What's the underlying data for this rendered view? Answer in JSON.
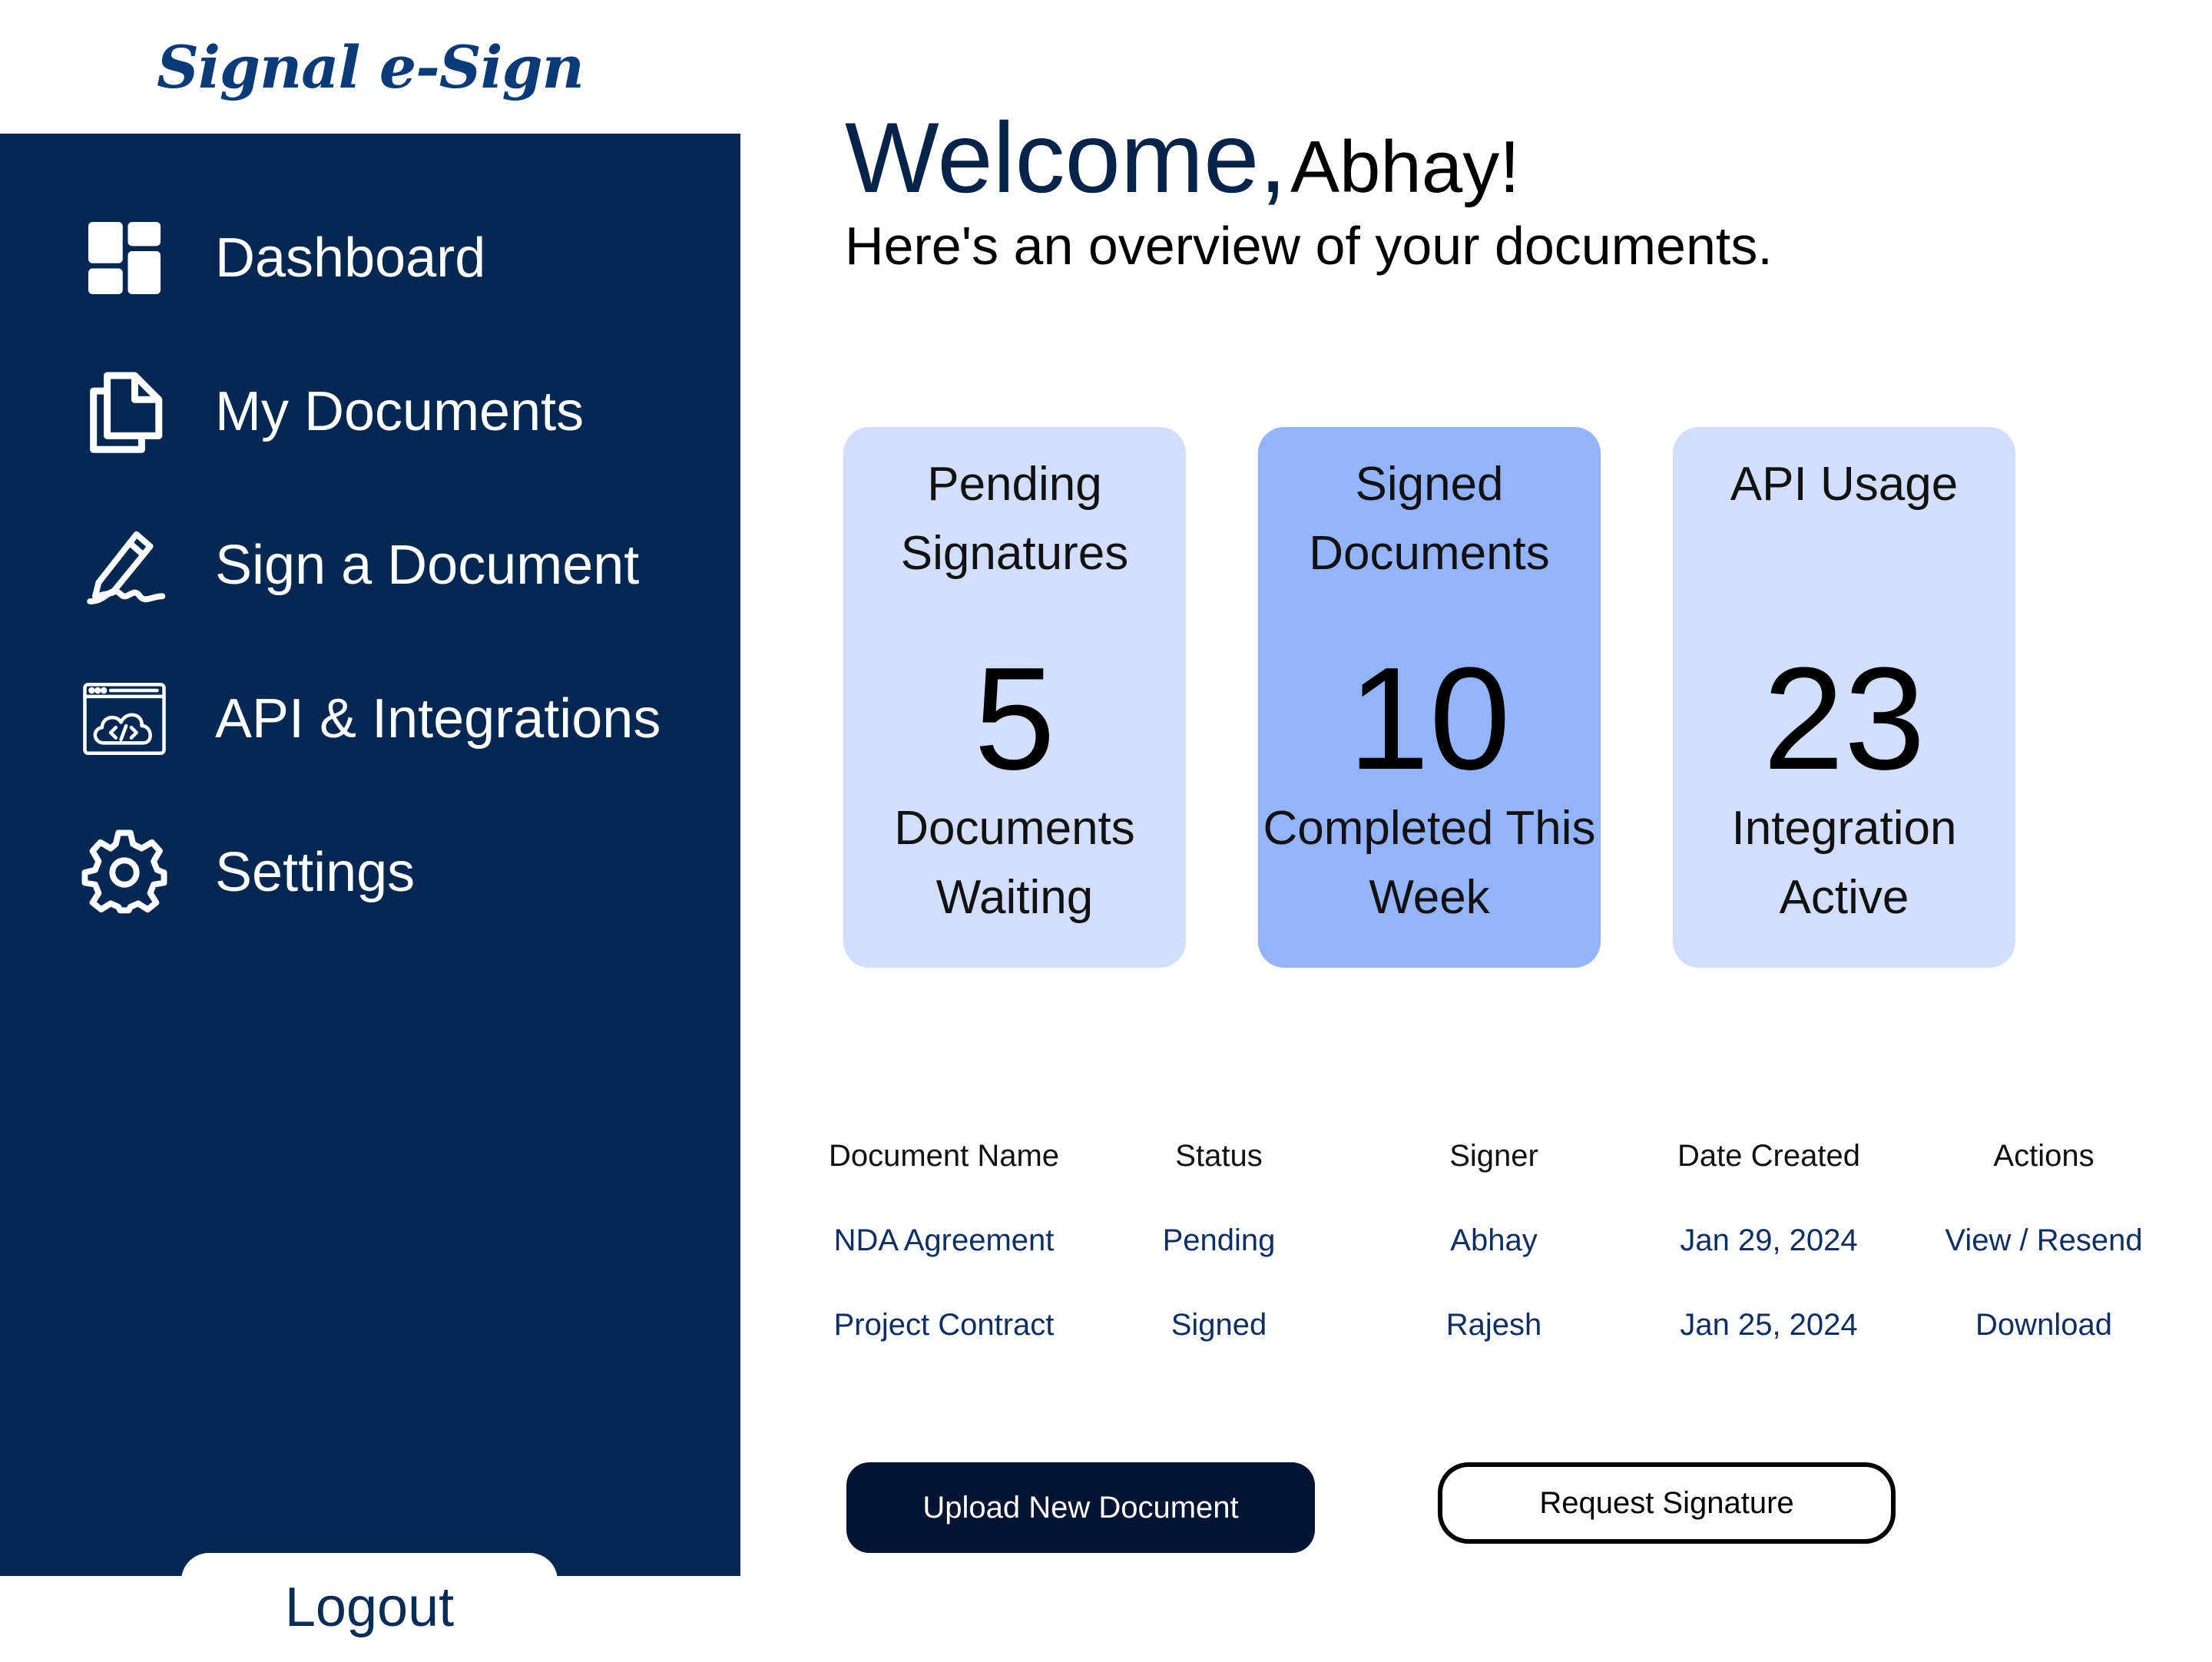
{
  "app": {
    "logo_text": "Signal e-Sign"
  },
  "sidebar": {
    "items": [
      {
        "label": "Dashboard",
        "icon": "dashboard-icon"
      },
      {
        "label": "My Documents",
        "icon": "documents-icon"
      },
      {
        "label": "Sign a Document",
        "icon": "signature-pen-icon"
      },
      {
        "label": "API & Integrations",
        "icon": "api-cloud-code-icon"
      },
      {
        "label": "Settings",
        "icon": "gear-icon"
      }
    ],
    "logout_label": "Logout"
  },
  "header": {
    "welcome": "Welcome,",
    "user_name": "Abhay!",
    "subtitle": "Here's an overview of your documents."
  },
  "cards": [
    {
      "title": "Pending Signatures",
      "value": "5",
      "description": "Documents Waiting",
      "bg": "#d1defd"
    },
    {
      "title": "Signed Documents",
      "value": "10",
      "description": "Completed This Week",
      "bg": "#94b4f9"
    },
    {
      "title": "API Usage",
      "value": "23",
      "description": "Integration Active",
      "bg": "#d1defd"
    }
  ],
  "table": {
    "headers": [
      "Document Name",
      "Status",
      "Signer",
      "Date Created",
      "Actions"
    ],
    "rows": [
      [
        "NDA Agreement",
        "Pending",
        "Abhay",
        "Jan 29, 2024",
        "View / Resend"
      ],
      [
        "Project Contract",
        "Signed",
        "Rajesh",
        "Jan 25, 2024",
        "Download"
      ]
    ]
  },
  "actions": {
    "upload_label": "Upload New Document",
    "request_label": "Request Signature"
  },
  "colors": {
    "sidebar_bg": "#052853",
    "brand": "#0a3a78",
    "primary_button": "#041532",
    "card_light": "#d1defd",
    "card_accent": "#94b4f9"
  }
}
